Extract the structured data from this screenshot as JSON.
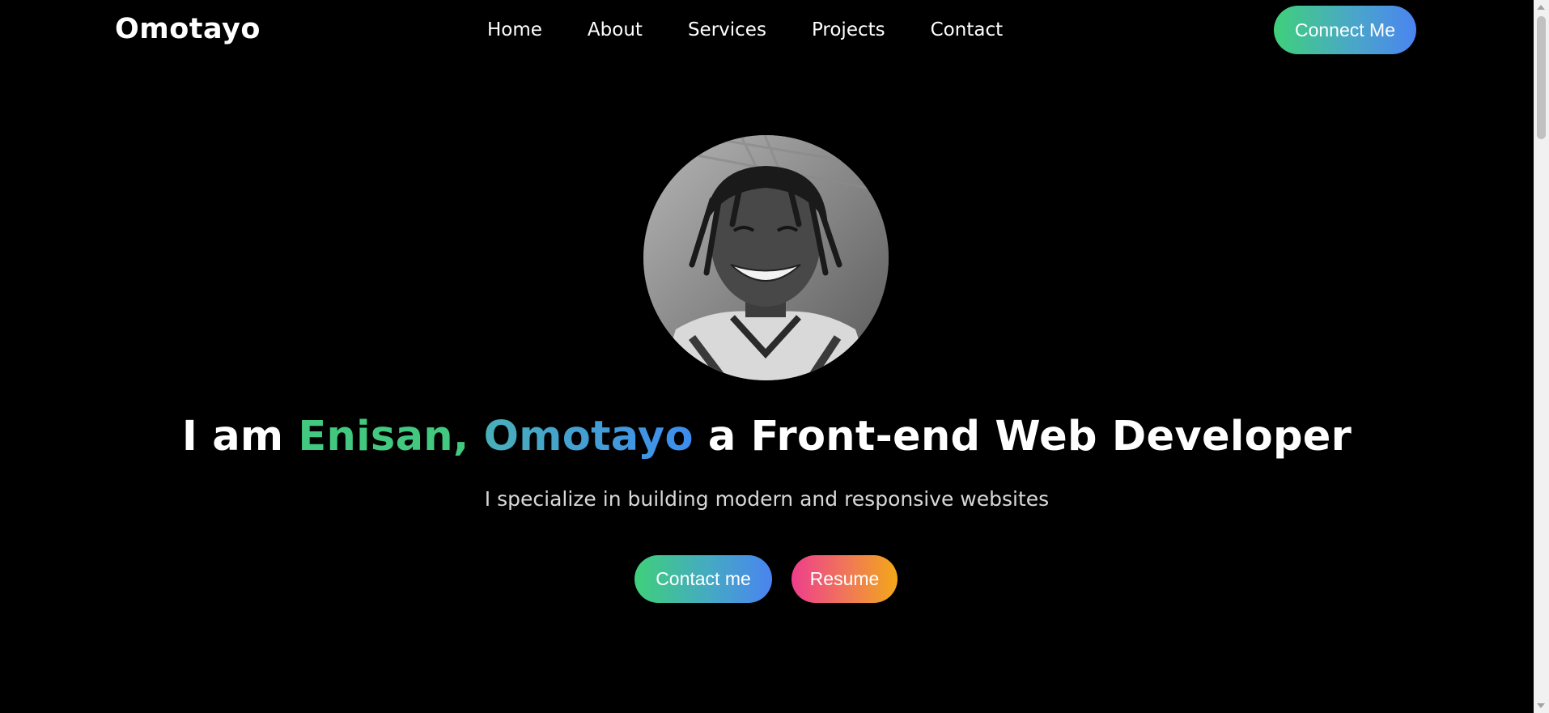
{
  "navbar": {
    "brand": "Omotayo",
    "links": [
      "Home",
      "About",
      "Services",
      "Projects",
      "Contact"
    ],
    "cta_label": "Connect Me"
  },
  "hero": {
    "headline": {
      "prefix": "I am ",
      "name_first": "Enisan,",
      "name_last": "Omotayo",
      "suffix": " a Front-end Web Developer"
    },
    "subtitle": "I specialize in building modern and responsive websites",
    "buttons": {
      "contact_label": "Contact me",
      "resume_label": "Resume"
    }
  },
  "colors": {
    "background": "#000000",
    "accent_green": "#42c97f",
    "accent_blue": "#4a84f0",
    "accent_pink": "#ee3e8c",
    "accent_orange": "#f2a818"
  }
}
